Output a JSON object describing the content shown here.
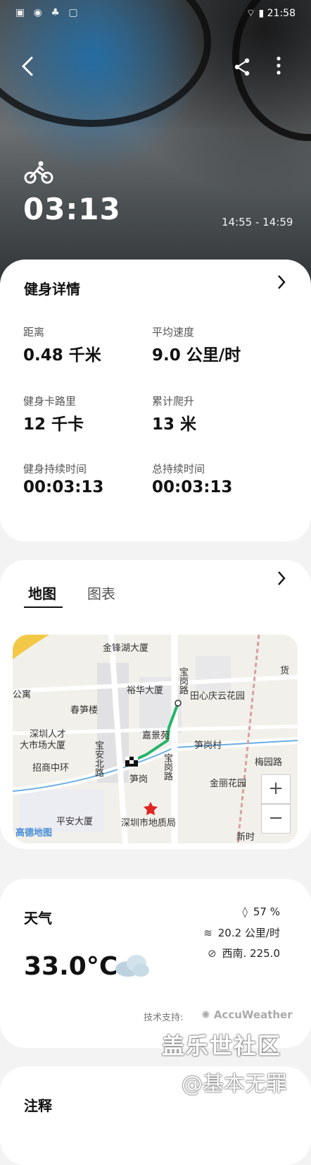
{
  "status_bar": {
    "left_icons": [
      "notification-icon",
      "wechat-icon",
      "app-icon",
      "lock-icon"
    ],
    "time": "21:58"
  },
  "header": {
    "duration": "03:13",
    "time_range": "14:55 - 14:59"
  },
  "details": {
    "title": "健身详情",
    "items": [
      {
        "label": "距离",
        "value": "0.48 千米"
      },
      {
        "label": "平均速度",
        "value": "9.0 公里/时"
      },
      {
        "label": "健身卡路里",
        "value": "12 千卡"
      },
      {
        "label": "累计爬升",
        "value": "13 米"
      },
      {
        "label": "健身持续时间",
        "value": "00:03:13"
      },
      {
        "label": "总持续时间",
        "value": "00:03:13"
      }
    ]
  },
  "map_section": {
    "tabs": [
      "地图",
      "图表"
    ],
    "labels": {
      "l1": "金锋湖大厦",
      "l2": "宝岗路",
      "l3": "裕华大厦",
      "l4": "田心庆云花园",
      "l5": "春笋楼",
      "l6": "嘉景苑",
      "l7": "笋岗村",
      "l8": "深圳人才",
      "l9": "大市场大厦",
      "l10": "宝安北路",
      "l11": "宝岗路",
      "l12": "梅园路",
      "l13": "招商中环",
      "l14": "笋岗",
      "l15": "金丽花园",
      "l16": "平安大厦",
      "l17": "深圳市地质局",
      "l18": "新时",
      "l19": "高德地图",
      "l20": "公寓",
      "l21": "货"
    },
    "zoom_in": "+",
    "zoom_out": "−"
  },
  "weather": {
    "title": "天气",
    "temperature": "33.0°C",
    "humidity": "57 %",
    "wind_speed": "20.2 公里/时",
    "wind_direction": "西南. 225.0",
    "powered_by": "技术支持:",
    "provider": "AccuWeather"
  },
  "notes": {
    "title": "注释"
  },
  "watermark": {
    "line1": "盖乐世社区",
    "line2": "@基本无罪"
  }
}
